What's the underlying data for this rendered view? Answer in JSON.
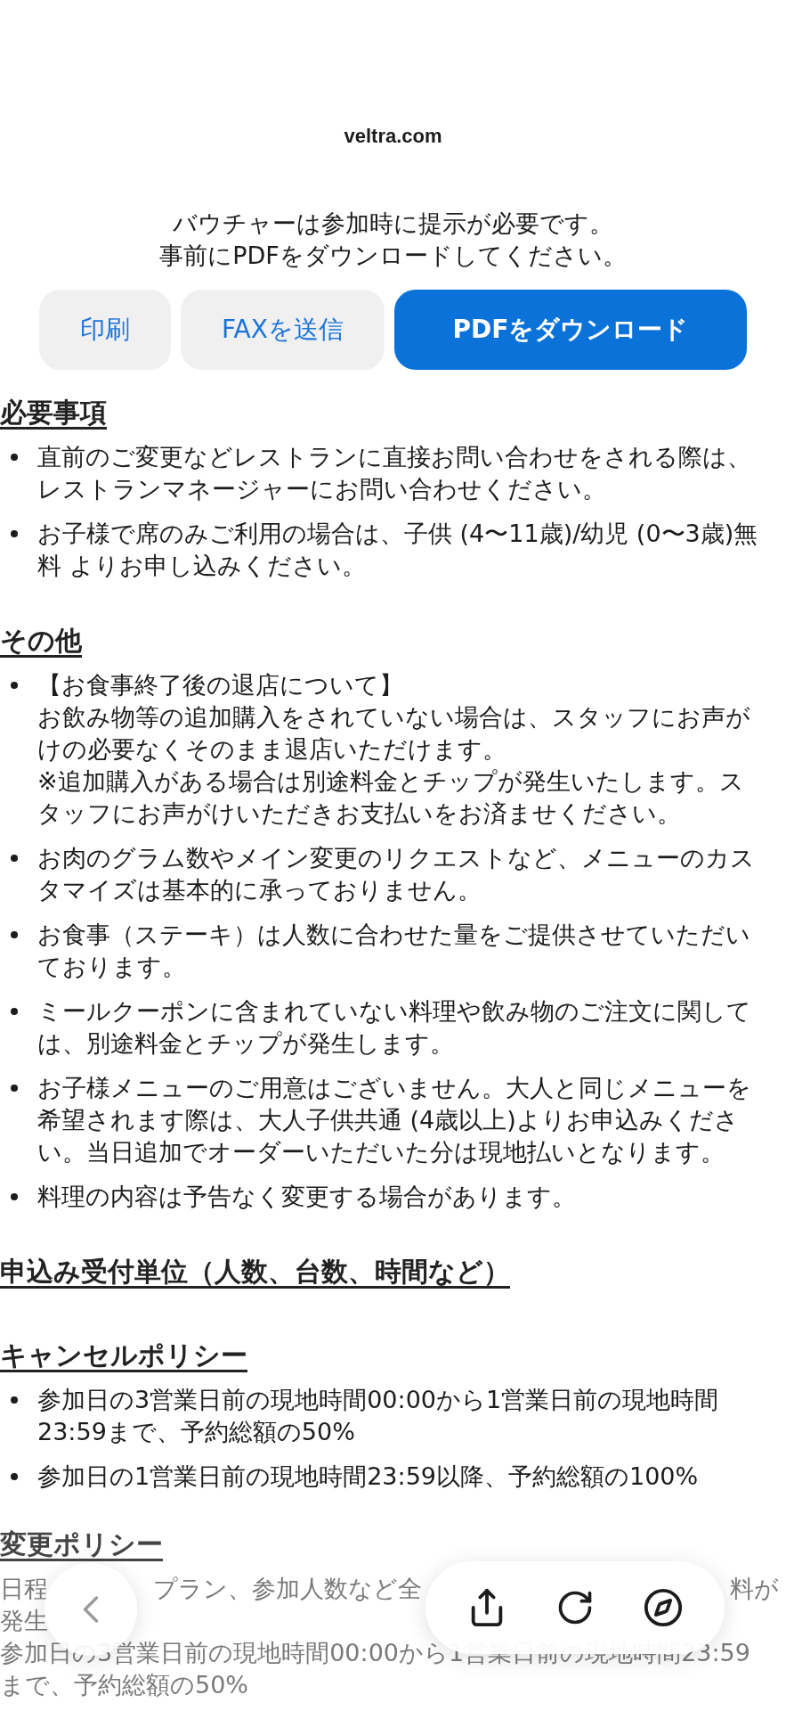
{
  "site": "veltra.com",
  "message": [
    "バウチャーは参加時に提示が必要です。",
    "事前にPDFをダウンロードしてください。"
  ],
  "buttons": [
    {
      "label": "印刷",
      "kind": "secondary"
    },
    {
      "label": "FAXを送信",
      "kind": "secondary"
    },
    {
      "label": "PDFをダウンロード",
      "kind": "primary"
    }
  ],
  "sections": [
    {
      "heading": "必要事項",
      "items": [
        [
          "直前のご変更などレストランに直接お問い合わせをされる際は、レストランマネージャーにお問い合わせください。"
        ],
        [
          "お子様で席のみご利用の場合は、子供 (4〜11歳)/幼児 (0〜3歳)無料 よりお申し込みください。"
        ]
      ]
    },
    {
      "heading": "その他",
      "items": [
        [
          "【お食事終了後の退店について】",
          "お飲み物等の追加購入をされていない場合は、スタッフにお声がけの必要なくそのまま退店いただけます。",
          "※追加購入がある場合は別途料金とチップが発生いたします。スタッフにお声がけいただきお支払いをお済ませください。"
        ],
        [
          "お肉のグラム数やメイン変更のリクエストなど、メニューのカスタマイズは基本的に承っておりません。"
        ],
        [
          "お食事（ステーキ）は人数に合わせた量をご提供させていただいております。"
        ],
        [
          "ミールクーポンに含まれていない料理や飲み物のご注文に関しては、別途料金とチップが発生します。"
        ],
        [
          "お子様メニューのご用意はございません。大人と同じメニューを希望されます際は、大人子供共通 (4歳以上)よりお申込みください。当日追加でオーダーいただいた分は現地払いとなります。"
        ],
        [
          "料理の内容は予告なく変更する場合があります。"
        ]
      ]
    },
    {
      "heading": "申込み受付単位（人数、台数、時間など）"
    },
    {
      "heading": "キャンセルポリシー",
      "items": [
        [
          "参加日の3営業日前の現地時間00:00から1営業日前の現地時間23:59まで、予約総額の50%"
        ],
        [
          "参加日の1営業日前の現地時間23:59以降、予約総額の100%"
        ]
      ]
    }
  ],
  "change_policy": {
    "heading": "変更ポリシー",
    "visible_lines": [
      [
        "日程",
        "プラン、参加人数など全",
        "料が"
      ],
      [
        "発生"
      ],
      [
        "参加日の3営業日前の現地時間00:00から1営業日前の現地時間23:59"
      ],
      [
        "まで、予約総額の50%"
      ]
    ]
  }
}
